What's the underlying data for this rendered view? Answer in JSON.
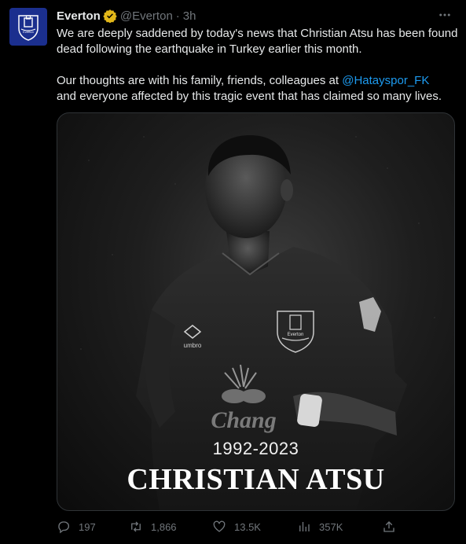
{
  "author": {
    "name": "Everton",
    "handle": "@Everton",
    "separator": "·",
    "time": "3h",
    "avatar_text": "Everton"
  },
  "tweet": {
    "paragraph1": "We are deeply saddened by today's news that Christian Atsu has been found dead following the earthquake in Turkey earlier this month.",
    "paragraph2_before": "Our thoughts are with his family, friends, colleagues at ",
    "mention": "@Hatayspor_FK",
    "paragraph2_after": "\nand everyone affected by this tragic event that has claimed so many lives."
  },
  "media": {
    "years": "1992-2023",
    "name": "CHRISTIAN ATSU",
    "crest_text": "Everton",
    "sponsor": "Chang",
    "kit_brand": "umbro"
  },
  "actions": {
    "replies": "197",
    "retweets": "1,866",
    "likes": "13.5K",
    "views": "357K"
  },
  "colors": {
    "background": "#000000",
    "text": "#e7e9ea",
    "muted": "#71767b",
    "link": "#1d9bf0",
    "avatar_blue": "#1b2f8e",
    "verified_gold": "#e2b719"
  }
}
